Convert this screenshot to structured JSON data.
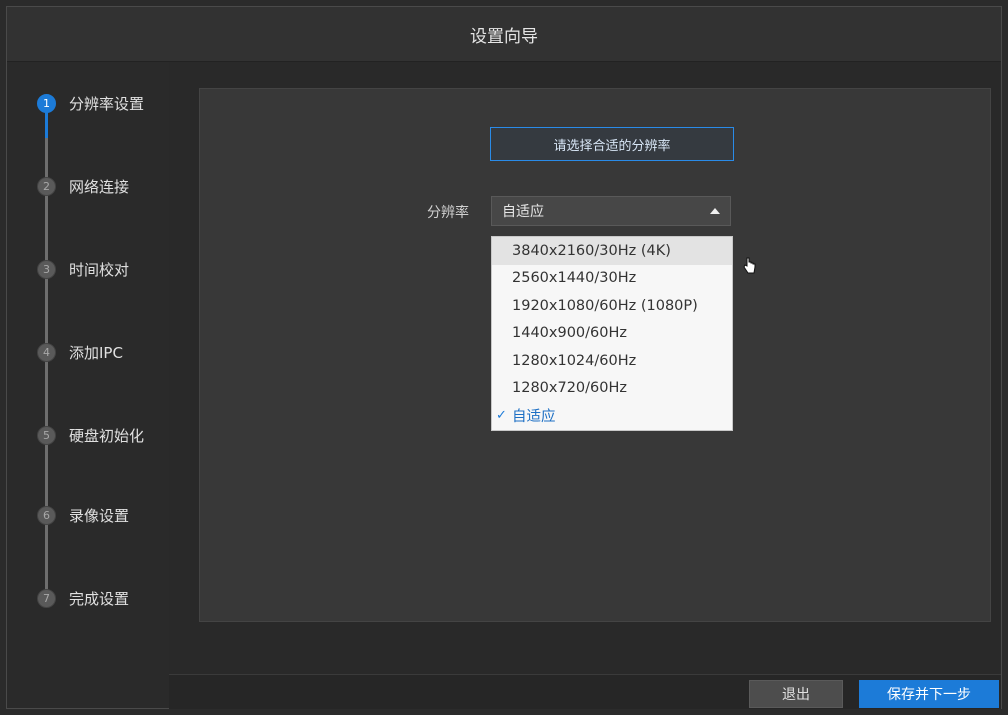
{
  "window": {
    "title": "设置向导"
  },
  "steps": [
    {
      "num": "1",
      "label": "分辨率设置",
      "active": true
    },
    {
      "num": "2",
      "label": "网络连接"
    },
    {
      "num": "3",
      "label": "时间校对"
    },
    {
      "num": "4",
      "label": "添加IPC"
    },
    {
      "num": "5",
      "label": "硬盘初始化"
    },
    {
      "num": "6",
      "label": "录像设置"
    },
    {
      "num": "7",
      "label": "完成设置"
    }
  ],
  "main": {
    "hint": "请选择合适的分辨率",
    "resolution_label": "分辨率",
    "resolution_value": "自适应",
    "options": [
      "3840x2160/30Hz (4K)",
      "2560x1440/30Hz",
      "1920x1080/60Hz (1080P)",
      "1440x900/60Hz",
      "1280x1024/60Hz",
      "1280x720/60Hz",
      "自适应"
    ],
    "selected_option": "自适应"
  },
  "footer": {
    "exit_label": "退出",
    "next_label": "保存并下一步"
  },
  "colors": {
    "accent": "#1c7bd8"
  }
}
